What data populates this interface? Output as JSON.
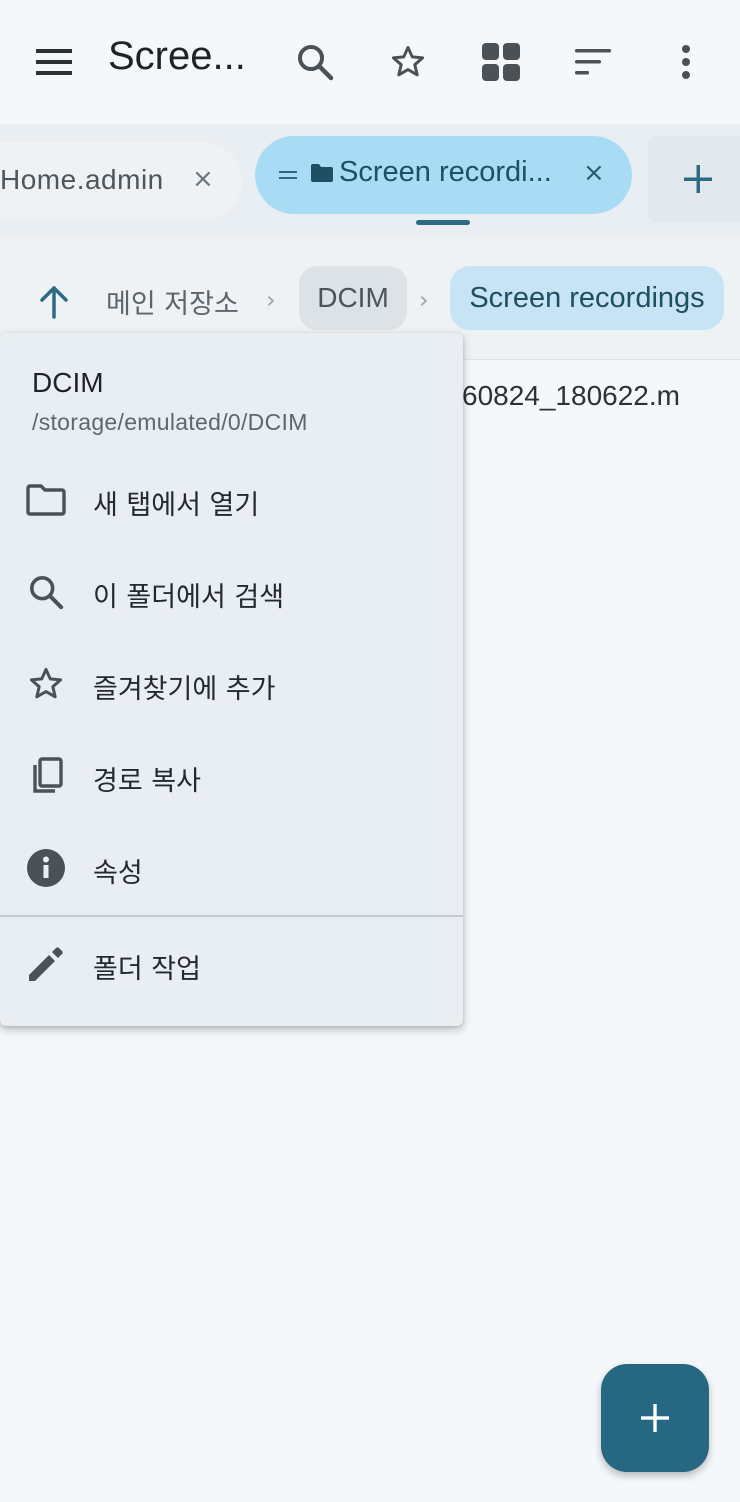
{
  "topbar": {
    "title": "Scree...",
    "icons": [
      "menu-icon",
      "search-icon",
      "star-icon",
      "grid-icon",
      "sort-icon",
      "more-vert-icon"
    ]
  },
  "tabs": {
    "items": [
      {
        "label": "Home.admin",
        "close": "×",
        "active": false
      },
      {
        "label": "Screen recordi...",
        "close": "×",
        "active": true
      }
    ],
    "add_label": "+"
  },
  "breadcrumb": {
    "items": [
      "메인 저장소",
      "DCIM",
      "Screen recordings"
    ],
    "separator": "›"
  },
  "file_list": {
    "visible_file": "60824_180622.m"
  },
  "menu": {
    "title": "DCIM",
    "path": "/storage/emulated/0/DCIM",
    "items": [
      {
        "label": "새 탭에서 열기",
        "icon": "folder-icon"
      },
      {
        "label": "이 폴더에서 검색",
        "icon": "search-icon"
      },
      {
        "label": "즐겨찾기에 추가",
        "icon": "star-icon"
      },
      {
        "label": "경로 복사",
        "icon": "copy-icon"
      },
      {
        "label": "속성",
        "icon": "info-icon"
      },
      {
        "label": "폴더 작업",
        "icon": "edit-icon"
      }
    ]
  },
  "colors": {
    "accent": "#266782",
    "active_tab": "#a8dcf5",
    "active_crumb": "#c7e4f4",
    "background": "#f5f8fb",
    "menu_background": "#e9eef3"
  }
}
